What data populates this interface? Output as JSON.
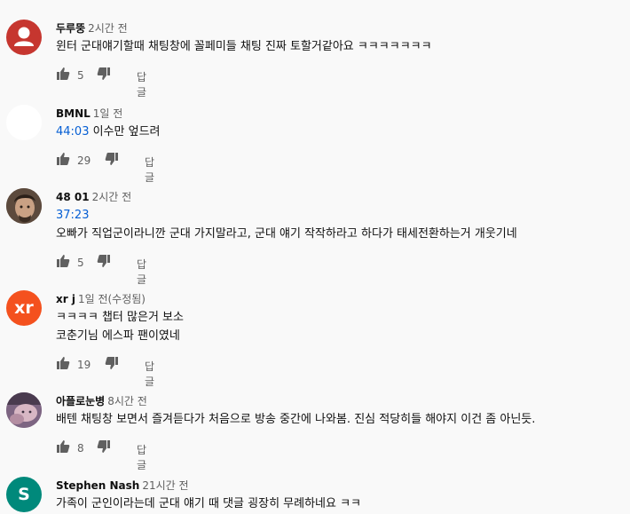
{
  "comments": [
    {
      "author": "두루뚱",
      "time": "2시간 전",
      "avatar": {
        "type": "default",
        "color": "#c6362f"
      },
      "lines": [
        {
          "timestamp": "",
          "text": "윈터 군대얘기할때 채팅창에 꼴페미들 채팅 진짜 토할거같아요 ㅋㅋㅋㅋㅋㅋㅋ"
        }
      ],
      "likes": "5",
      "reply": "답글"
    },
    {
      "author": "BMNL",
      "time": "1일 전",
      "avatar": {
        "type": "blank",
        "color": "#ffffff"
      },
      "lines": [
        {
          "timestamp": "44:03",
          "text": " 이수만 엎드려"
        }
      ],
      "likes": "29",
      "reply": "답글"
    },
    {
      "author": "48 01",
      "time": "2시간 전",
      "avatar": {
        "type": "photo",
        "color": "#6b5a4a"
      },
      "lines": [
        {
          "timestamp": "37:23",
          "text": ""
        },
        {
          "timestamp": "",
          "text": "오빠가 직업군이라니깐 군대 가지말라고, 군대 얘기 작작하라고 하다가 태세전환하는거 개웃기네"
        }
      ],
      "likes": "5",
      "reply": "답글"
    },
    {
      "author": "xr j",
      "time": "1일 전(수정됨)",
      "avatar": {
        "type": "letter",
        "letter": "xr",
        "color": "#f4511e"
      },
      "lines": [
        {
          "timestamp": "",
          "text": "ㅋㅋㅋㅋ 챕터 많은거 보소"
        },
        {
          "timestamp": "",
          "text": "코춘기님 에스파 팬이였네"
        }
      ],
      "likes": "19",
      "reply": "답글"
    },
    {
      "author": "아플로눈병",
      "time": "8시간 전",
      "avatar": {
        "type": "photo",
        "color": "#8a6f8f"
      },
      "lines": [
        {
          "timestamp": "",
          "text": "배텐 채팅창 보면서 즐겨듣다가 처음으로 방송 중간에 나와봄. 진심 적당히들 해야지 이건 좀 아닌듯."
        }
      ],
      "likes": "8",
      "reply": "답글"
    },
    {
      "author": "Stephen Nash",
      "time": "21시간 전",
      "avatar": {
        "type": "letter",
        "letter": "S",
        "color": "#00897b"
      },
      "lines": [
        {
          "timestamp": "",
          "text": "가족이 군인이라는데 군대 얘기 때 댓글 굉장히 무례하네요 ㅋㅋ"
        }
      ],
      "likes": "",
      "reply": ""
    }
  ]
}
